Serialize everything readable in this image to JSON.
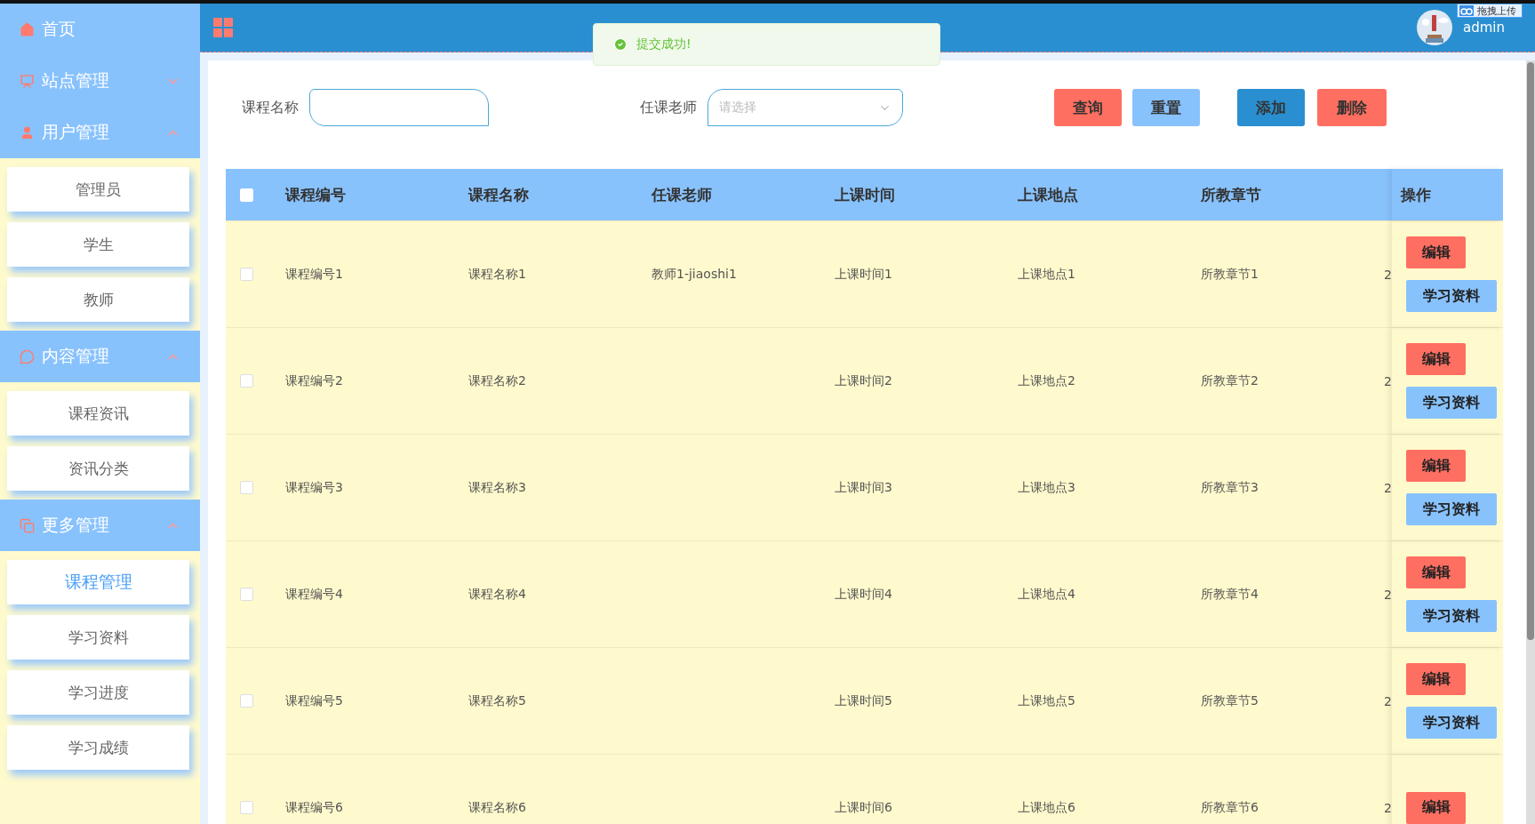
{
  "sidebar": {
    "menus": [
      {
        "label": "首页"
      },
      {
        "label": "站点管理",
        "expanded": false
      },
      {
        "label": "用户管理",
        "expanded": true,
        "children": [
          {
            "label": "管理员",
            "selected": false
          },
          {
            "label": "学生",
            "selected": false
          },
          {
            "label": "教师",
            "selected": false
          }
        ]
      },
      {
        "label": "内容管理",
        "expanded": true,
        "children": [
          {
            "label": "课程资讯",
            "selected": false
          },
          {
            "label": "资讯分类",
            "selected": false
          }
        ]
      },
      {
        "label": "更多管理",
        "expanded": true,
        "children": [
          {
            "label": "课程管理",
            "selected": true
          },
          {
            "label": "学习资料",
            "selected": false
          },
          {
            "label": "学习进度",
            "selected": false
          },
          {
            "label": "学习成绩",
            "selected": false
          }
        ]
      }
    ]
  },
  "header": {
    "user": "admin",
    "upload_badge": "拖拽上传"
  },
  "toast": {
    "message": "提交成功!"
  },
  "search": {
    "fields": [
      {
        "kind": "input",
        "label": "课程名称"
      },
      {
        "kind": "select",
        "label": "任课老师",
        "placeholder": "请选择"
      }
    ],
    "buttons": [
      {
        "label": "查询",
        "color": "#ff6f61"
      },
      {
        "label": "重置",
        "color": "#88c2fd"
      },
      {
        "label": "添加",
        "color": "#2a8fd0"
      },
      {
        "label": "删除",
        "color": "#ff6f61"
      }
    ]
  },
  "table": {
    "select_all": {
      "checked": false
    },
    "columns": [
      "课程编号",
      "课程名称",
      "任课老师",
      "上课时间",
      "上课地点",
      "所教章节",
      "",
      "操作"
    ],
    "rows": [
      {
        "checked": false,
        "cells": [
          "课程编号1",
          "课程名称1",
          "教师1-jiaoshi1",
          "上课时间1",
          "上课地点1",
          "所教章节1",
          "2"
        ],
        "actions": [
          "编辑",
          "学习资料"
        ]
      },
      {
        "checked": false,
        "cells": [
          "课程编号2",
          "课程名称2",
          "",
          "上课时间2",
          "上课地点2",
          "所教章节2",
          "2"
        ],
        "actions": [
          "编辑",
          "学习资料"
        ]
      },
      {
        "checked": false,
        "cells": [
          "课程编号3",
          "课程名称3",
          "",
          "上课时间3",
          "上课地点3",
          "所教章节3",
          "2"
        ],
        "actions": [
          "编辑",
          "学习资料"
        ]
      },
      {
        "checked": false,
        "cells": [
          "课程编号4",
          "课程名称4",
          "",
          "上课时间4",
          "上课地点4",
          "所教章节4",
          "2"
        ],
        "actions": [
          "编辑",
          "学习资料"
        ]
      },
      {
        "checked": false,
        "cells": [
          "课程编号5",
          "课程名称5",
          "",
          "上课时间5",
          "上课地点5",
          "所教章节5",
          "2"
        ],
        "actions": [
          "编辑",
          "学习资料"
        ]
      },
      {
        "checked": false,
        "cells": [
          "课程编号6",
          "课程名称6",
          "",
          "上课时间6",
          "上课地点6",
          "所教章节6",
          "2"
        ],
        "actions": [
          "编辑"
        ]
      }
    ]
  }
}
